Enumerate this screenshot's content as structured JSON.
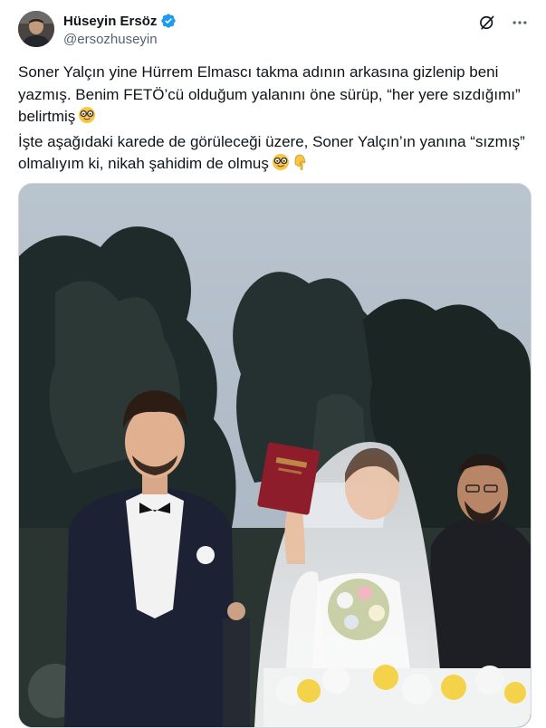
{
  "author": {
    "name": "Hüseyin Ersöz",
    "handle": "@ersozhuseyin",
    "verified_color": "#1d9bf0"
  },
  "actions": {
    "grok_icon": "grok-icon",
    "more_icon": "more-icon"
  },
  "tweet": {
    "line1": "Soner Yalçın yine Hürrem Elmascı takma adının arkasına gizlenip beni yazmış. Benim FETÖ’cü olduğum yalanını öne sürüp, “her yere sızdığımı” belirtmiş",
    "line2": "İşte aşağıdaki karede de görüleceği üzere, Soner Yalçın’ın yanına “sızmış” olmalıyım ki, nikah şahidim de olmuş"
  },
  "media": {
    "type": "photo",
    "description_icon": "wedding-photo"
  }
}
